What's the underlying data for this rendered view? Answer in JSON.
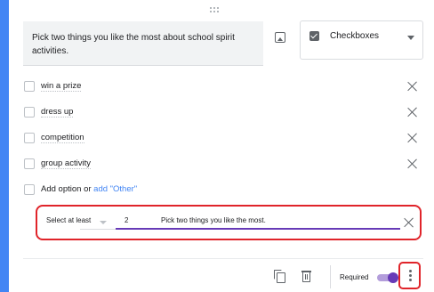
{
  "question": {
    "title": "Pick two things you like the most about school spirit activities."
  },
  "question_type": {
    "label": "Checkboxes",
    "icon": "checkbox-icon"
  },
  "options": [
    {
      "label": "win a prize"
    },
    {
      "label": "dress up"
    },
    {
      "label": "competition"
    },
    {
      "label": "group activity"
    }
  ],
  "add_option": {
    "prefix": "Add option or ",
    "other_link": "add \"Other\""
  },
  "validation": {
    "rule": "Select at least",
    "number": "2",
    "error_text": "Pick two things you like the most."
  },
  "footer": {
    "required_label": "Required",
    "required_on": true
  },
  "colors": {
    "accent": "#4285f4",
    "toggle": "#673ab7",
    "highlight": "#e0242a",
    "link": "#4285f4"
  }
}
